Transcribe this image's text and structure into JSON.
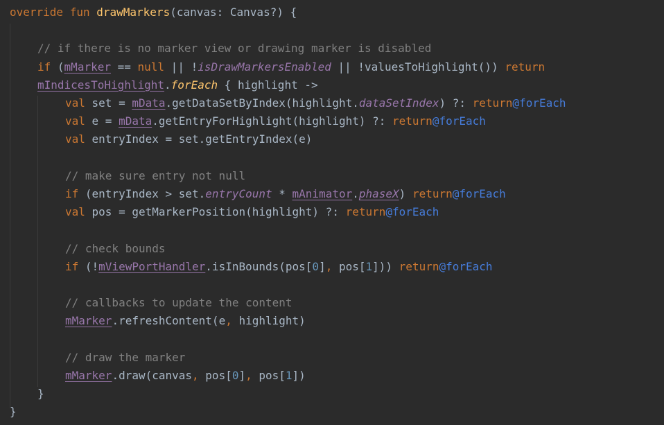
{
  "editor": {
    "lines": [
      {
        "indent": 0,
        "tokens": [
          {
            "c": "k",
            "v": "override fun "
          },
          {
            "c": "f",
            "v": "drawMarkers"
          },
          {
            "c": "t",
            "v": "(canvas: Canvas?) {"
          }
        ]
      },
      {
        "indent": 0,
        "tokens": []
      },
      {
        "indent": 1,
        "tokens": [
          {
            "c": "c",
            "v": "// if there is no marker view or drawing marker is disabled"
          }
        ]
      },
      {
        "indent": 1,
        "tokens": [
          {
            "c": "k",
            "v": "if "
          },
          {
            "c": "t",
            "v": "("
          },
          {
            "c": "p",
            "v": "mMarker"
          },
          {
            "c": "t",
            "v": " == "
          },
          {
            "c": "k",
            "v": "null"
          },
          {
            "c": "t",
            "v": " || !"
          },
          {
            "c": "pi",
            "v": "isDrawMarkersEnabled"
          },
          {
            "c": "t",
            "v": " || !valuesToHighlight()) "
          },
          {
            "c": "k",
            "v": "return"
          }
        ]
      },
      {
        "indent": 1,
        "tokens": [
          {
            "c": "p",
            "v": "mIndicesToHighlight"
          },
          {
            "c": "t",
            "v": "."
          },
          {
            "c": "fi",
            "v": "forEach"
          },
          {
            "c": "t",
            "v": " { highlight ->"
          }
        ]
      },
      {
        "indent": 2,
        "tokens": [
          {
            "c": "k",
            "v": "val "
          },
          {
            "c": "t",
            "v": "set = "
          },
          {
            "c": "p",
            "v": "mData"
          },
          {
            "c": "t",
            "v": ".getDataSetByIndex(highlight."
          },
          {
            "c": "pi",
            "v": "dataSetIndex"
          },
          {
            "c": "t",
            "v": ") ?: "
          },
          {
            "c": "k",
            "v": "return"
          },
          {
            "c": "l",
            "v": "@forEach"
          }
        ]
      },
      {
        "indent": 2,
        "tokens": [
          {
            "c": "k",
            "v": "val "
          },
          {
            "c": "t",
            "v": "e = "
          },
          {
            "c": "p",
            "v": "mData"
          },
          {
            "c": "t",
            "v": ".getEntryForHighlight(highlight) ?: "
          },
          {
            "c": "k",
            "v": "return"
          },
          {
            "c": "l",
            "v": "@forEach"
          }
        ]
      },
      {
        "indent": 2,
        "tokens": [
          {
            "c": "k",
            "v": "val "
          },
          {
            "c": "t",
            "v": "entryIndex = set.getEntryIndex(e)"
          }
        ]
      },
      {
        "indent": 0,
        "tokens": []
      },
      {
        "indent": 2,
        "tokens": [
          {
            "c": "c",
            "v": "// make sure entry not null"
          }
        ]
      },
      {
        "indent": 2,
        "tokens": [
          {
            "c": "k",
            "v": "if "
          },
          {
            "c": "t",
            "v": "(entryIndex > set."
          },
          {
            "c": "pi",
            "v": "entryCount"
          },
          {
            "c": "t",
            "v": " * "
          },
          {
            "c": "p",
            "v": "mAnimator"
          },
          {
            "c": "t",
            "v": "."
          },
          {
            "c": "piu",
            "v": "phaseX"
          },
          {
            "c": "t",
            "v": ") "
          },
          {
            "c": "k",
            "v": "return"
          },
          {
            "c": "l",
            "v": "@forEach"
          }
        ]
      },
      {
        "indent": 2,
        "tokens": [
          {
            "c": "k",
            "v": "val "
          },
          {
            "c": "t",
            "v": "pos = getMarkerPosition(highlight) ?: "
          },
          {
            "c": "k",
            "v": "return"
          },
          {
            "c": "l",
            "v": "@forEach"
          }
        ]
      },
      {
        "indent": 0,
        "tokens": []
      },
      {
        "indent": 2,
        "tokens": [
          {
            "c": "c",
            "v": "// check bounds"
          }
        ]
      },
      {
        "indent": 2,
        "tokens": [
          {
            "c": "k",
            "v": "if "
          },
          {
            "c": "t",
            "v": "(!"
          },
          {
            "c": "p",
            "v": "mViewPortHandler"
          },
          {
            "c": "t",
            "v": ".isInBounds(pos["
          },
          {
            "c": "n",
            "v": "0"
          },
          {
            "c": "t",
            "v": "]"
          },
          {
            "c": "k",
            "v": ", "
          },
          {
            "c": "t",
            "v": "pos["
          },
          {
            "c": "n",
            "v": "1"
          },
          {
            "c": "t",
            "v": "])) "
          },
          {
            "c": "k",
            "v": "return"
          },
          {
            "c": "l",
            "v": "@forEach"
          }
        ]
      },
      {
        "indent": 0,
        "tokens": []
      },
      {
        "indent": 2,
        "tokens": [
          {
            "c": "c",
            "v": "// callbacks to update the content"
          }
        ]
      },
      {
        "indent": 2,
        "tokens": [
          {
            "c": "p",
            "v": "mMarker"
          },
          {
            "c": "t",
            "v": ".refreshContent(e"
          },
          {
            "c": "k",
            "v": ", "
          },
          {
            "c": "t",
            "v": "highlight)"
          }
        ]
      },
      {
        "indent": 0,
        "tokens": []
      },
      {
        "indent": 2,
        "tokens": [
          {
            "c": "c",
            "v": "// draw the marker"
          }
        ]
      },
      {
        "indent": 2,
        "tokens": [
          {
            "c": "p",
            "v": "mMarker"
          },
          {
            "c": "t",
            "v": ".draw(canvas"
          },
          {
            "c": "k",
            "v": ", "
          },
          {
            "c": "t",
            "v": "pos["
          },
          {
            "c": "n",
            "v": "0"
          },
          {
            "c": "t",
            "v": "]"
          },
          {
            "c": "k",
            "v": ", "
          },
          {
            "c": "t",
            "v": "pos["
          },
          {
            "c": "n",
            "v": "1"
          },
          {
            "c": "t",
            "v": "])"
          }
        ]
      },
      {
        "indent": 1,
        "tokens": [
          {
            "c": "t",
            "v": "}"
          }
        ]
      },
      {
        "indent": 0,
        "tokens": [
          {
            "c": "t",
            "v": "}"
          }
        ]
      }
    ]
  }
}
